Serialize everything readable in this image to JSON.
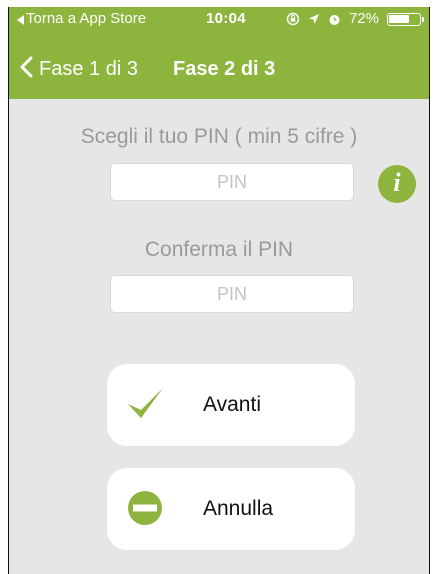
{
  "status_bar": {
    "back_app": "Torna a App Store",
    "time": "10:04",
    "battery": "72%",
    "battery_level": 0.72
  },
  "nav": {
    "back_label": "Fase 1 di 3",
    "title": "Fase 2 di 3"
  },
  "form": {
    "pin_label": "Scegli il tuo PIN ( min 5 cifre )",
    "pin_placeholder": "PIN",
    "confirm_label": "Conferma il PIN",
    "confirm_placeholder": "PIN",
    "info_letter": "i"
  },
  "actions": {
    "next_label": "Avanti",
    "cancel_label": "Annulla"
  },
  "colors": {
    "brand_green": "#8db43c",
    "background": "#e6e6e6"
  }
}
